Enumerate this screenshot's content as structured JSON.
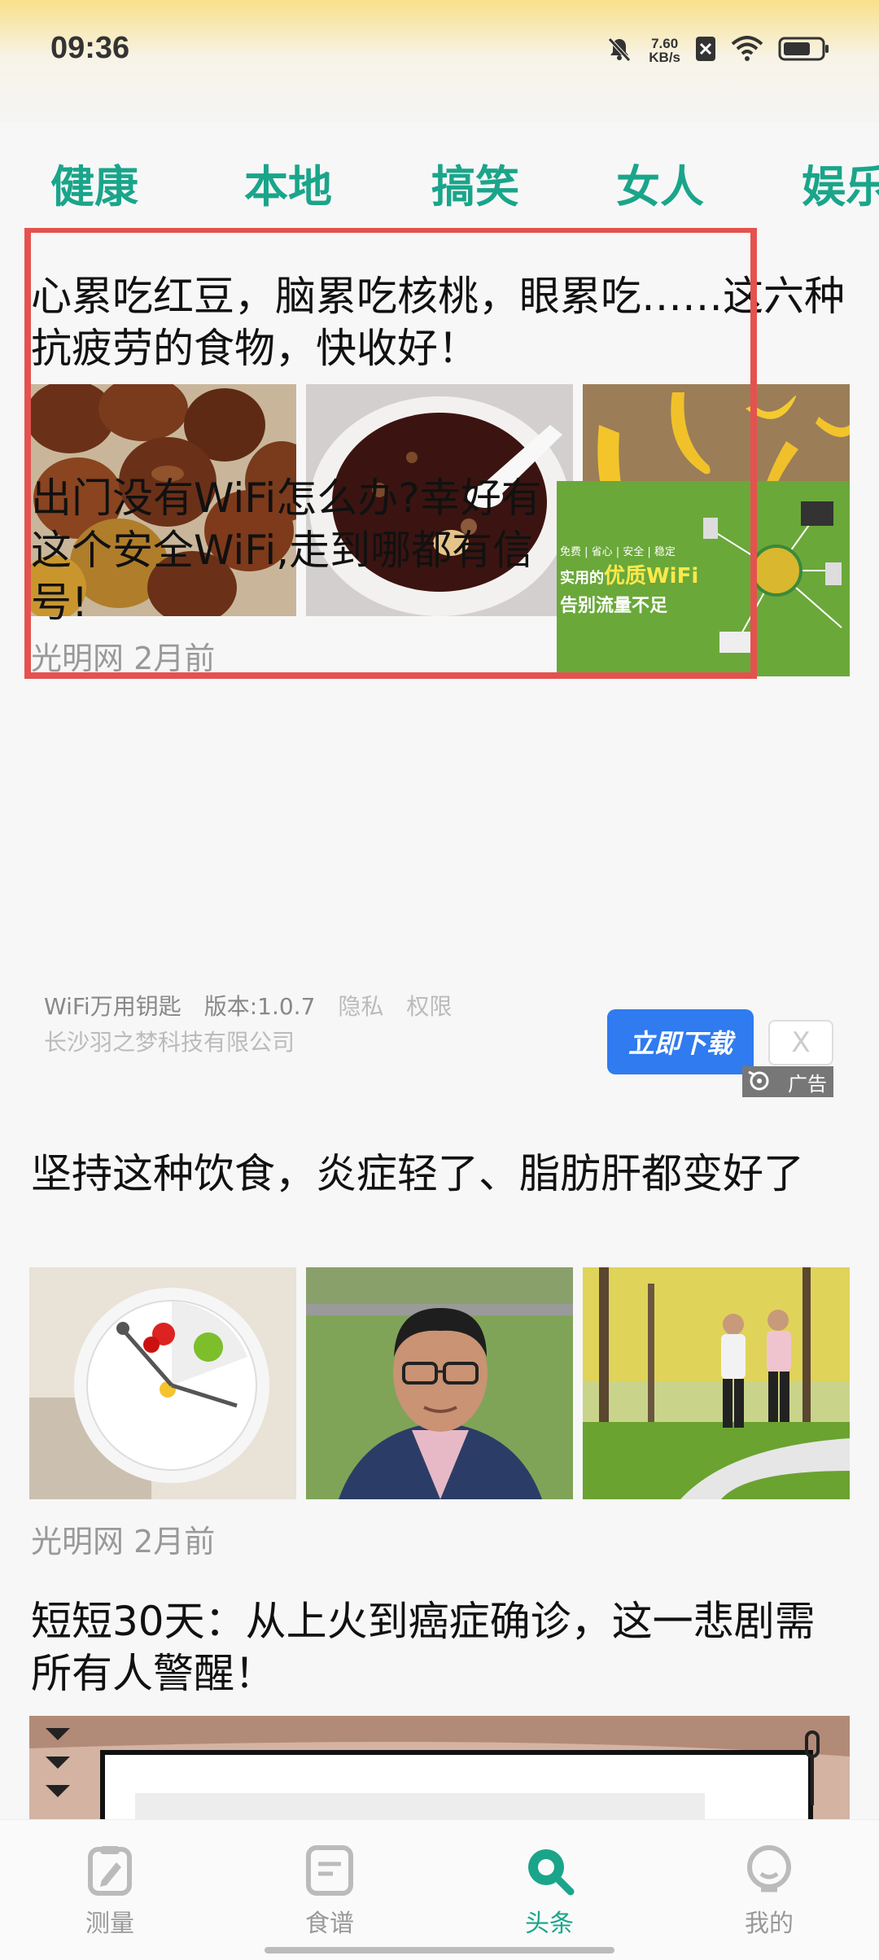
{
  "status_bar": {
    "time": "09:36",
    "net_speed_value": "7.60",
    "net_speed_unit": "KB/s",
    "icons": [
      "mute-icon",
      "net-speed",
      "sim-off-icon",
      "wifi-icon",
      "battery-icon"
    ]
  },
  "tabs": [
    {
      "label": "健康",
      "active": true
    },
    {
      "label": "本地",
      "active": false
    },
    {
      "label": "搞笑",
      "active": false
    },
    {
      "label": "女人",
      "active": false
    },
    {
      "label": "娱乐",
      "active": false
    }
  ],
  "articles": [
    {
      "title": "心累吃红豆，脑累吃核桃，眼累吃……这六种抗疲劳的食物，快收好！",
      "images": [
        "chestnuts-image",
        "red-bean-porridge-image",
        "bananas-image"
      ],
      "source": "光明网",
      "time": "2月前",
      "highlighted": true
    },
    {
      "title": "坚持这种饮食，炎症轻了、脂肪肝都变好了",
      "images": [
        "clock-plate-image",
        "man-portrait-image",
        "couple-walking-image"
      ],
      "source": "光明网",
      "time": "2月前"
    },
    {
      "title": "短短30天：从上火到癌症确诊，这一悲剧需所有人警醒！",
      "images": [
        "banner-image"
      ]
    }
  ],
  "ad": {
    "title": "出门没有WiFi怎么办?幸好有这个安全WiFi,走到哪都有信号!",
    "image_text_small": "免费 | 省心 | 安全 | 稳定",
    "image_text_main_prefix": "实用的",
    "image_text_main_highlight": "优质WiFi",
    "image_text_sub": "告别流量不足",
    "app_name": "WiFi万用钥匙",
    "version": "版本:1.0.7",
    "privacy": "隐私",
    "permission": "权限",
    "company": "长沙羽之梦科技有限公司",
    "download_button": "立即下载",
    "close_button": "X",
    "ad_label": "广告"
  },
  "bottom_nav": [
    {
      "label": "测量",
      "icon": "clipboard-icon",
      "active": false
    },
    {
      "label": "食谱",
      "icon": "recipe-icon",
      "active": false
    },
    {
      "label": "头条",
      "icon": "search-icon",
      "active": true
    },
    {
      "label": "我的",
      "icon": "profile-icon",
      "active": false
    }
  ],
  "colors": {
    "accent": "#1aa58a",
    "highlight_border": "#e4524f",
    "download_button": "#2f7bef"
  }
}
